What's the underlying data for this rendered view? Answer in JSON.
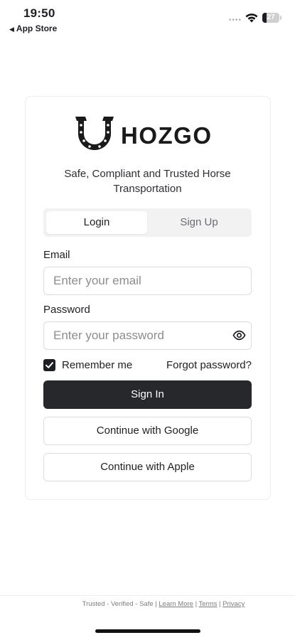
{
  "status_bar": {
    "time": "19:50",
    "back_label": "App Store",
    "battery_level": "27",
    "battery_fraction": 0.27
  },
  "brand": {
    "name": "HOZGO",
    "tagline": "Safe, Compliant and Trusted Horse Transportation"
  },
  "tabs": {
    "login": "Login",
    "signup": "Sign Up",
    "active": "login"
  },
  "form": {
    "email_label": "Email",
    "email_placeholder": "Enter your email",
    "email_value": "",
    "password_label": "Password",
    "password_placeholder": "Enter your password",
    "password_value": "",
    "remember_label": "Remember me",
    "remember_checked": true,
    "forgot_label": "Forgot password?"
  },
  "buttons": {
    "sign_in": "Sign In",
    "google": "Continue with Google",
    "apple": "Continue with Apple"
  },
  "footer": {
    "prefix": "Trusted - Verified - Safe | ",
    "learn_more": "Learn More",
    "sep1": " | ",
    "terms": "Terms",
    "sep2": " | ",
    "privacy": "Privacy"
  },
  "icons": {
    "logo": "horseshoe-icon",
    "password_toggle": "eye-icon",
    "checkbox": "checkmark-icon"
  },
  "colors": {
    "primary_button": "#27282c",
    "text": "#1e1f24",
    "border": "#dcdcde",
    "muted": "#8c8d92"
  }
}
